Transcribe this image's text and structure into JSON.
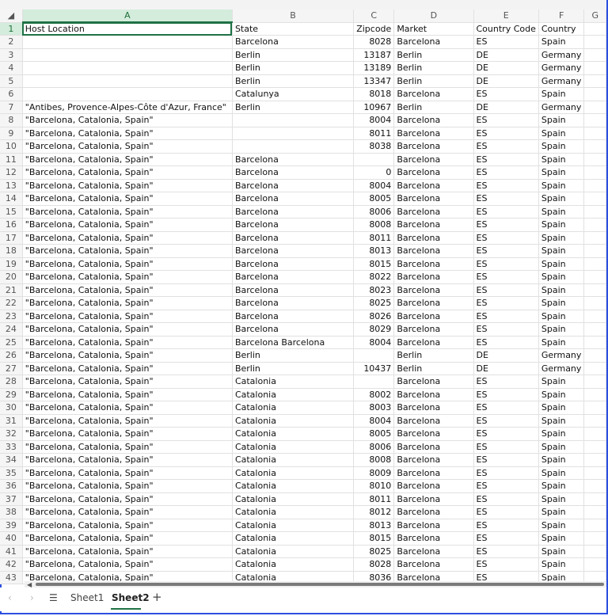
{
  "columns": [
    "A",
    "B",
    "C",
    "D",
    "E",
    "F",
    "G"
  ],
  "active_cell": "A1",
  "rows": [
    [
      "Host Location",
      "State",
      "Zipcode",
      "Market",
      "Country Code",
      "Country"
    ],
    [
      "",
      "Barcelona",
      "8028",
      "Barcelona",
      "ES",
      "Spain"
    ],
    [
      "",
      "Berlin",
      "13187",
      "Berlin",
      "DE",
      "Germany"
    ],
    [
      "",
      "Berlin",
      "13189",
      "Berlin",
      "DE",
      "Germany"
    ],
    [
      "",
      "Berlin",
      "13347",
      "Berlin",
      "DE",
      "Germany"
    ],
    [
      "",
      "Catalunya",
      "8018",
      "Barcelona",
      "ES",
      "Spain"
    ],
    [
      "\"Antibes, Provence-Alpes-Côte d'Azur, France\"",
      "Berlin",
      "10967",
      "Berlin",
      "DE",
      "Germany"
    ],
    [
      "\"Barcelona, Catalonia, Spain\"",
      "",
      "8004",
      "Barcelona",
      "ES",
      "Spain"
    ],
    [
      "\"Barcelona, Catalonia, Spain\"",
      "",
      "8011",
      "Barcelona",
      "ES",
      "Spain"
    ],
    [
      "\"Barcelona, Catalonia, Spain\"",
      "",
      "8038",
      "Barcelona",
      "ES",
      "Spain"
    ],
    [
      "\"Barcelona, Catalonia, Spain\"",
      "Barcelona",
      "",
      "Barcelona",
      "ES",
      "Spain"
    ],
    [
      "\"Barcelona, Catalonia, Spain\"",
      "Barcelona",
      "0",
      "Barcelona",
      "ES",
      "Spain"
    ],
    [
      "\"Barcelona, Catalonia, Spain\"",
      "Barcelona",
      "8004",
      "Barcelona",
      "ES",
      "Spain"
    ],
    [
      "\"Barcelona, Catalonia, Spain\"",
      "Barcelona",
      "8005",
      "Barcelona",
      "ES",
      "Spain"
    ],
    [
      "\"Barcelona, Catalonia, Spain\"",
      "Barcelona",
      "8006",
      "Barcelona",
      "ES",
      "Spain"
    ],
    [
      "\"Barcelona, Catalonia, Spain\"",
      "Barcelona",
      "8008",
      "Barcelona",
      "ES",
      "Spain"
    ],
    [
      "\"Barcelona, Catalonia, Spain\"",
      "Barcelona",
      "8011",
      "Barcelona",
      "ES",
      "Spain"
    ],
    [
      "\"Barcelona, Catalonia, Spain\"",
      "Barcelona",
      "8013",
      "Barcelona",
      "ES",
      "Spain"
    ],
    [
      "\"Barcelona, Catalonia, Spain\"",
      "Barcelona",
      "8015",
      "Barcelona",
      "ES",
      "Spain"
    ],
    [
      "\"Barcelona, Catalonia, Spain\"",
      "Barcelona",
      "8022",
      "Barcelona",
      "ES",
      "Spain"
    ],
    [
      "\"Barcelona, Catalonia, Spain\"",
      "Barcelona",
      "8023",
      "Barcelona",
      "ES",
      "Spain"
    ],
    [
      "\"Barcelona, Catalonia, Spain\"",
      "Barcelona",
      "8025",
      "Barcelona",
      "ES",
      "Spain"
    ],
    [
      "\"Barcelona, Catalonia, Spain\"",
      "Barcelona",
      "8026",
      "Barcelona",
      "ES",
      "Spain"
    ],
    [
      "\"Barcelona, Catalonia, Spain\"",
      "Barcelona",
      "8029",
      "Barcelona",
      "ES",
      "Spain"
    ],
    [
      "\"Barcelona, Catalonia, Spain\"",
      "Barcelona Barcelona",
      "8004",
      "Barcelona",
      "ES",
      "Spain"
    ],
    [
      "\"Barcelona, Catalonia, Spain\"",
      "Berlin",
      "",
      "Berlin",
      "DE",
      "Germany"
    ],
    [
      "\"Barcelona, Catalonia, Spain\"",
      "Berlin",
      "10437",
      "Berlin",
      "DE",
      "Germany"
    ],
    [
      "\"Barcelona, Catalonia, Spain\"",
      "Catalonia",
      "",
      "Barcelona",
      "ES",
      "Spain"
    ],
    [
      "\"Barcelona, Catalonia, Spain\"",
      "Catalonia",
      "8002",
      "Barcelona",
      "ES",
      "Spain"
    ],
    [
      "\"Barcelona, Catalonia, Spain\"",
      "Catalonia",
      "8003",
      "Barcelona",
      "ES",
      "Spain"
    ],
    [
      "\"Barcelona, Catalonia, Spain\"",
      "Catalonia",
      "8004",
      "Barcelona",
      "ES",
      "Spain"
    ],
    [
      "\"Barcelona, Catalonia, Spain\"",
      "Catalonia",
      "8005",
      "Barcelona",
      "ES",
      "Spain"
    ],
    [
      "\"Barcelona, Catalonia, Spain\"",
      "Catalonia",
      "8006",
      "Barcelona",
      "ES",
      "Spain"
    ],
    [
      "\"Barcelona, Catalonia, Spain\"",
      "Catalonia",
      "8008",
      "Barcelona",
      "ES",
      "Spain"
    ],
    [
      "\"Barcelona, Catalonia, Spain\"",
      "Catalonia",
      "8009",
      "Barcelona",
      "ES",
      "Spain"
    ],
    [
      "\"Barcelona, Catalonia, Spain\"",
      "Catalonia",
      "8010",
      "Barcelona",
      "ES",
      "Spain"
    ],
    [
      "\"Barcelona, Catalonia, Spain\"",
      "Catalonia",
      "8011",
      "Barcelona",
      "ES",
      "Spain"
    ],
    [
      "\"Barcelona, Catalonia, Spain\"",
      "Catalonia",
      "8012",
      "Barcelona",
      "ES",
      "Spain"
    ],
    [
      "\"Barcelona, Catalonia, Spain\"",
      "Catalonia",
      "8013",
      "Barcelona",
      "ES",
      "Spain"
    ],
    [
      "\"Barcelona, Catalonia, Spain\"",
      "Catalonia",
      "8015",
      "Barcelona",
      "ES",
      "Spain"
    ],
    [
      "\"Barcelona, Catalonia, Spain\"",
      "Catalonia",
      "8025",
      "Barcelona",
      "ES",
      "Spain"
    ],
    [
      "\"Barcelona, Catalonia, Spain\"",
      "Catalonia",
      "8028",
      "Barcelona",
      "ES",
      "Spain"
    ],
    [
      "\"Barcelona, Catalonia, Spain\"",
      "Catalonia",
      "8036",
      "Barcelona",
      "ES",
      "Spain"
    ]
  ],
  "sheet_tabs": {
    "prev": "‹",
    "next": "›",
    "menu": "☰",
    "tabs": [
      "Sheet1",
      "Sheet2"
    ],
    "active": "Sheet2",
    "add": "+"
  },
  "colors": {
    "accent": "#217346",
    "window_border": "#2b4fe0"
  }
}
